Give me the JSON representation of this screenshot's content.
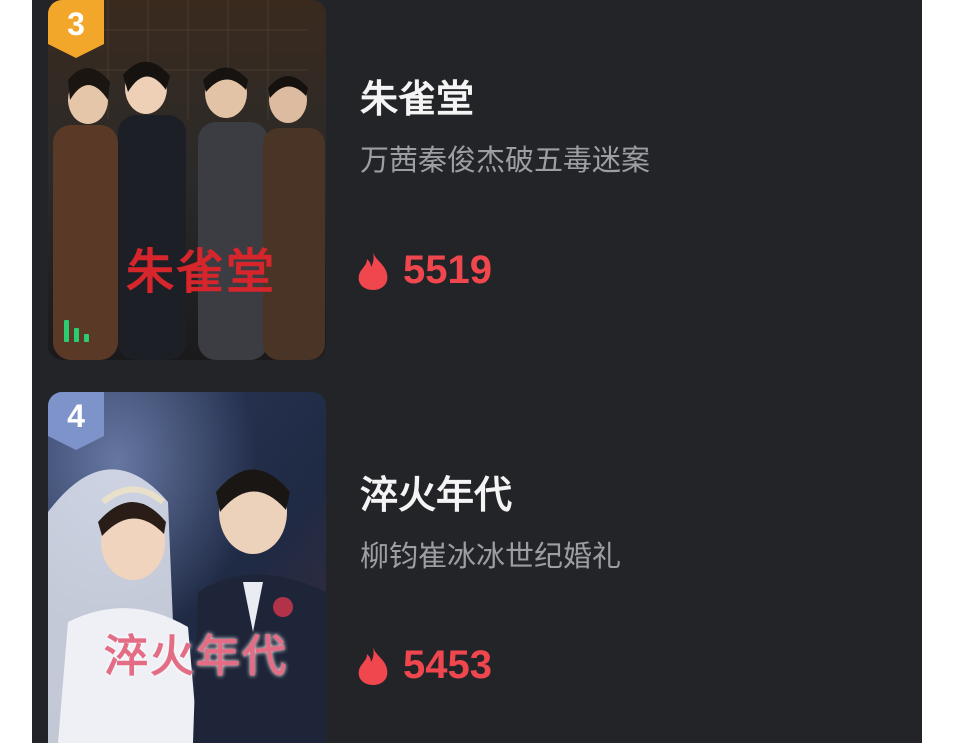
{
  "items": [
    {
      "rank": "3",
      "title": "朱雀堂",
      "subtitle": "万茜秦俊杰破五毒迷案",
      "heat": "5519",
      "poster_text": "朱雀堂",
      "badge_color": "#f2a62a"
    },
    {
      "rank": "4",
      "title": "淬火年代",
      "subtitle": "柳钧崔冰冰世纪婚礼",
      "heat": "5453",
      "poster_text": "淬火年代",
      "badge_color": "#7d93c9"
    }
  ],
  "colors": {
    "background": "#232427",
    "heat": "#f0474e",
    "title": "#f4f4f4",
    "subtitle": "#9c9ea3",
    "trend_icon": "#2ecc71"
  },
  "icons": {
    "heat": "flame-icon",
    "trend": "bar-chart-icon"
  }
}
